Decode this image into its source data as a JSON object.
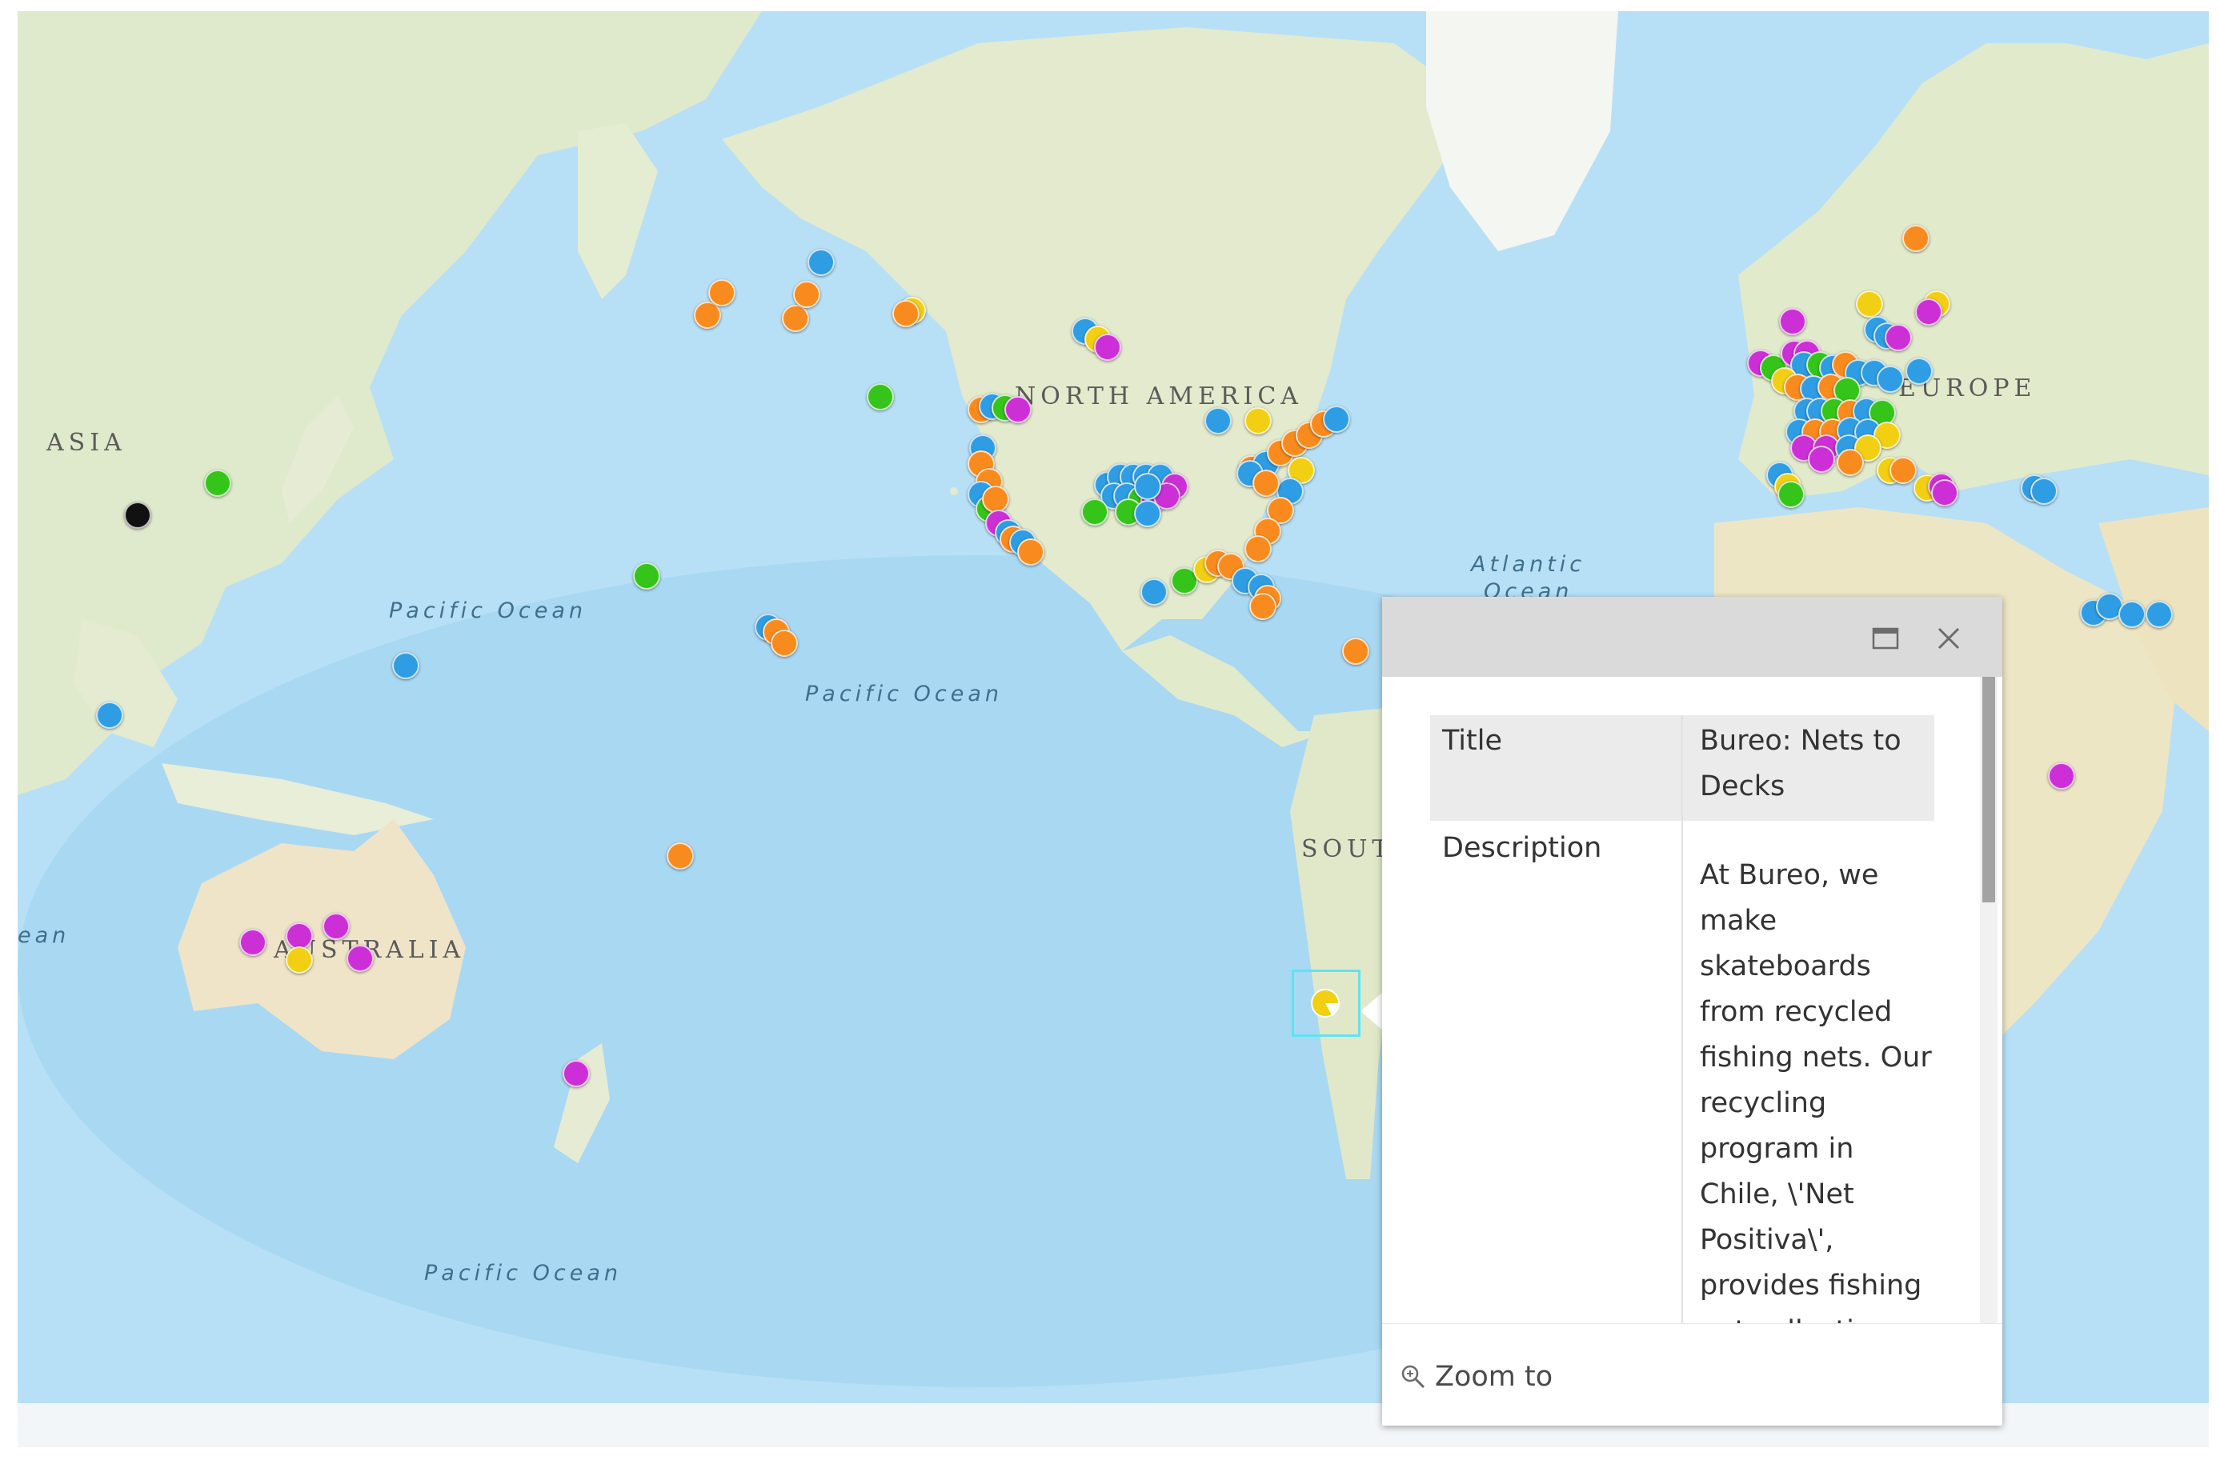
{
  "map": {
    "continent_labels": {
      "asia": "ASIA",
      "north_america": "NORTH AMERICA",
      "europe": "EUROPE",
      "south": "SOUT",
      "australia": "AUSTRALIA"
    },
    "ocean_labels": {
      "pacific_1": "Pacific Ocean",
      "pacific_2": "Pacific Ocean",
      "pacific_3": "Pacific Ocean",
      "atlantic_line1": "Atlantic",
      "atlantic_line2": "Ocean",
      "indian_fragment": "ean"
    },
    "marker_colors": {
      "orange": "#f98b1e",
      "blue": "#2f9de3",
      "green": "#35c41a",
      "magenta": "#cd2fd6",
      "yellow": "#f2cf12",
      "black": "#111111"
    },
    "selection_color": "#5fe3f0"
  },
  "popup": {
    "maximize_icon": "maximize-icon",
    "close_icon": "close-icon",
    "fields": {
      "title_label": "Title",
      "title_value": "Bureo: Nets to Decks",
      "description_label": "Description",
      "description_value": "At Bureo, we make skateboards from recycled fishing nets. Our recycling program in Chile, \\'Net Positiva\\', provides fishing net collection"
    },
    "footer": {
      "zoom_icon": "zoom-in-icon",
      "zoom_label": "Zoom to"
    }
  }
}
